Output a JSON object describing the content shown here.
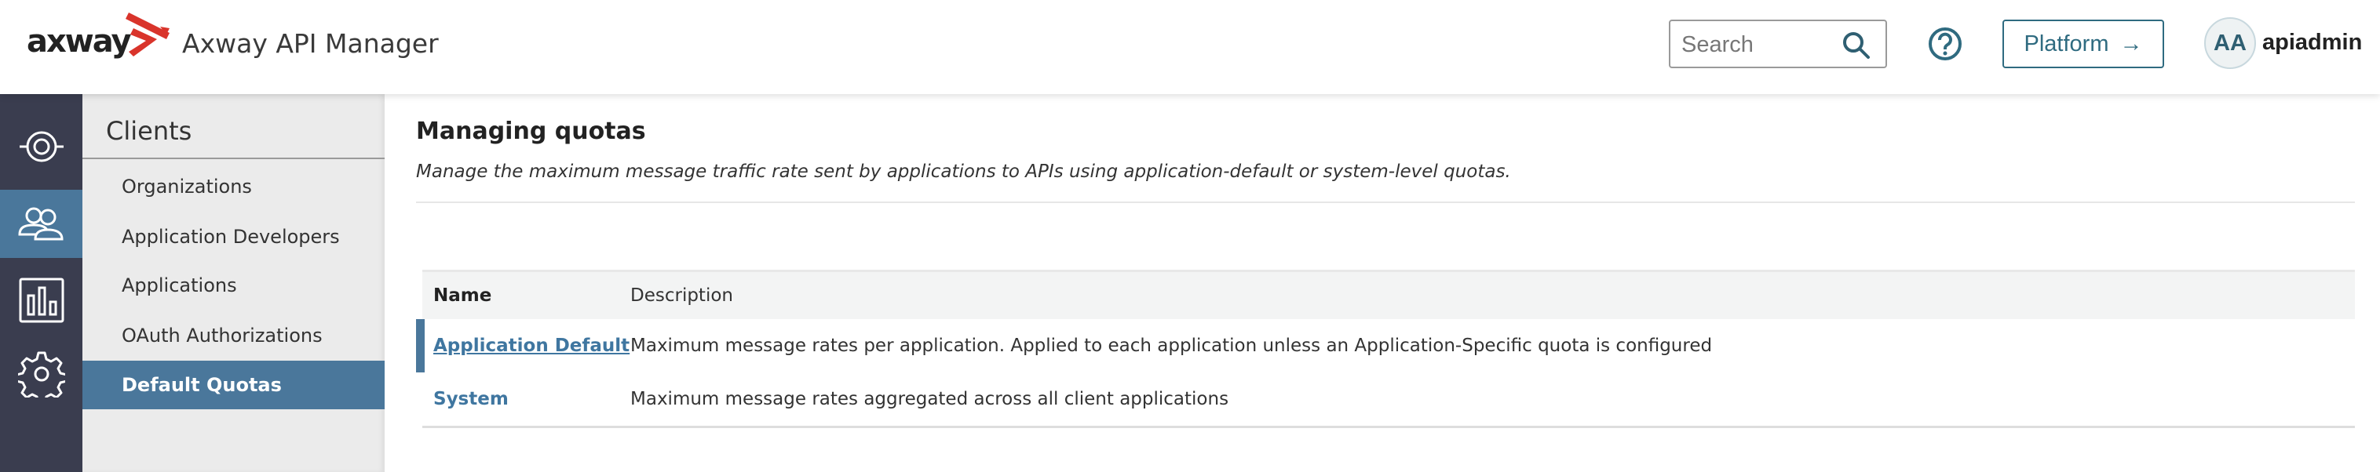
{
  "header": {
    "logo_text": "axway",
    "app_title": "Axway API Manager",
    "search_placeholder": "Search",
    "platform_label": "Platform",
    "avatar_initials": "AA",
    "username": "apiadmin"
  },
  "icon_bar": [
    {
      "icon": "target-icon",
      "active": false
    },
    {
      "icon": "users-icon",
      "active": true
    },
    {
      "icon": "chart-icon",
      "active": false
    },
    {
      "icon": "gear-icon",
      "active": false
    }
  ],
  "subnav": {
    "title": "Clients",
    "items": [
      {
        "label": "Organizations"
      },
      {
        "label": "Application Developers"
      },
      {
        "label": "Applications"
      },
      {
        "label": "OAuth Authorizations"
      },
      {
        "label": "Default Quotas",
        "active": true
      }
    ]
  },
  "main": {
    "title": "Managing quotas",
    "description": "Manage the maximum message traffic rate sent by applications to APIs using application-default or system-level quotas.",
    "table": {
      "columns": [
        "Name",
        "Description"
      ],
      "rows": [
        {
          "name": "Application Default",
          "description": "Maximum message rates per application. Applied to each application unless an Application-Specific quota is configured",
          "selected": true
        },
        {
          "name": "System",
          "description": "Maximum message rates aggregated across all client applications",
          "selected": false
        }
      ]
    }
  },
  "colors": {
    "accent": "#4a779b",
    "iconbar": "#3a3d4f",
    "brand_red": "#d9342b",
    "link": "#3f76a0",
    "button": "#2f6b80"
  }
}
